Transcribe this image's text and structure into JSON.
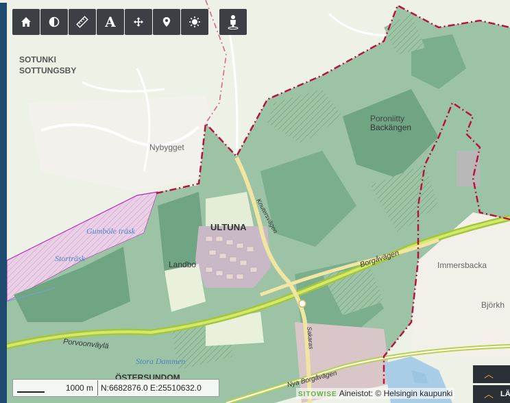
{
  "toolbar": {
    "tools": [
      "home-icon",
      "contrast-icon",
      "ruler-icon",
      "text-icon",
      "move-icon",
      "marker-icon",
      "sun-icon"
    ],
    "text_tool_label": "A",
    "person_tool": "person-icon"
  },
  "places": {
    "sotunki_line1": "SOTUNKI",
    "sotunki_line2": "SOTTUNGSBY",
    "nybygget": "Nybygget",
    "poroniitty_line1": "Poroniitty",
    "poroniitty_line2": "Backängen",
    "ultuna": "ULTUNA",
    "landbo": "Landbo",
    "immersbacka": "Immersbacka",
    "bjorkh": "Björkh",
    "ostersundom": "ÖSTERSUNDOM"
  },
  "water": {
    "gumbole": "Gumböle träsk",
    "stortrask": "Storträsk",
    "stora_dammen": "Stora Dammen"
  },
  "roads": {
    "porvoonvayla": "Porvoonväylä",
    "bordavagen": "Borgåvägen",
    "knutersvagen": "Knutersvägen",
    "nya_borgavagen": "Nya Borgåvägen",
    "sakaras": "Sakaras"
  },
  "scale": {
    "label": "1000 m"
  },
  "coordinates": "N:6682876.0 E:25510632.0",
  "attribution": {
    "brand": "SITOWISE",
    "text": "Aineistot: © Helsingin kaupunki"
  },
  "corner_button": {
    "label": "LÄ"
  },
  "colors": {
    "forest": "#8fb89a",
    "forest_dark": "#5e9a78",
    "boundary": "#b5143c",
    "conservation": "#e6b8e0",
    "highway": "#b6d43c",
    "water": "#a9cde6",
    "ui_dark": "#3c3f44"
  }
}
